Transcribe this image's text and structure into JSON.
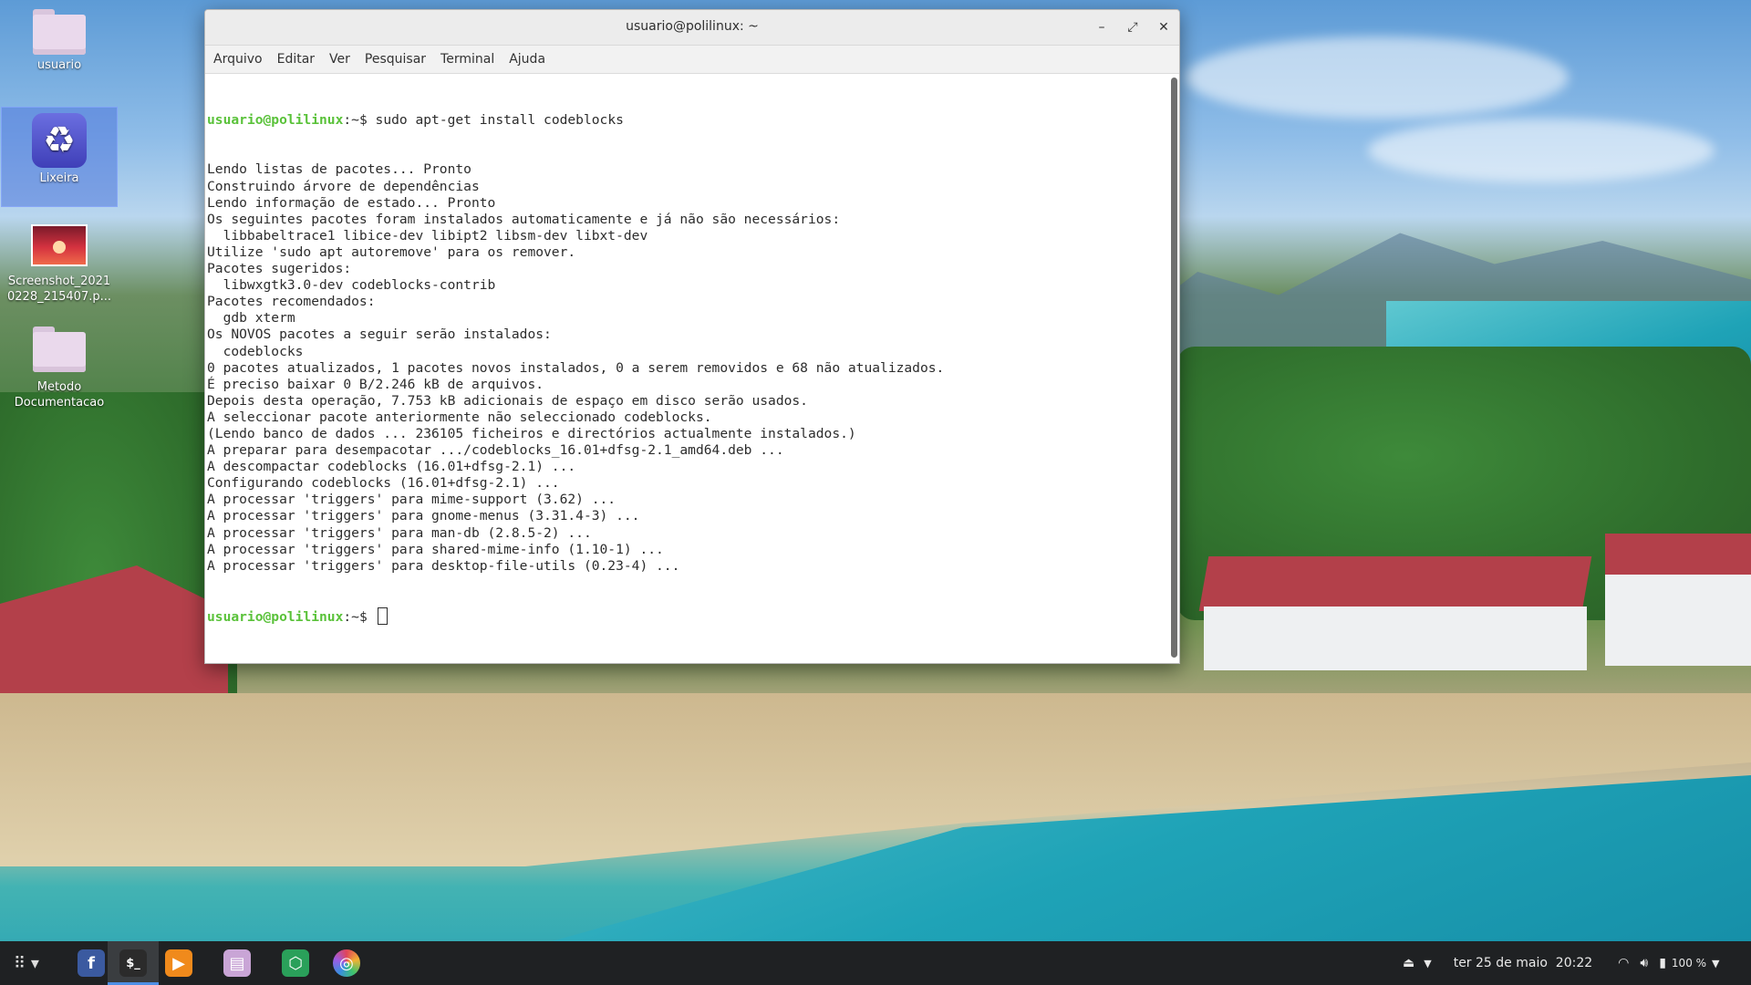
{
  "desktop": {
    "icons": [
      {
        "label": "usuario",
        "icon": "folder-icon"
      },
      {
        "label": "Lixeira",
        "icon": "trash-icon"
      },
      {
        "label": "Screenshot_2021\n0228_215407.p...",
        "icon": "image-file-icon"
      },
      {
        "label": "Metodo\nDocumentacao",
        "icon": "folder-icon"
      }
    ]
  },
  "window": {
    "title": "usuario@polilinux: ~",
    "buttons": {
      "minimize": "–",
      "maximize": "⤢",
      "close": "✕"
    },
    "menu": [
      "Arquivo",
      "Editar",
      "Ver",
      "Pesquisar",
      "Terminal",
      "Ajuda"
    ]
  },
  "terminal": {
    "prompt_user": "usuario@polilinux",
    "prompt_suffix": ":~$ ",
    "command": "sudo apt-get install codeblocks",
    "output": [
      "Lendo listas de pacotes... Pronto",
      "Construindo árvore de dependências",
      "Lendo informação de estado... Pronto",
      "Os seguintes pacotes foram instalados automaticamente e já não são necessários:",
      "  libbabeltrace1 libice-dev libipt2 libsm-dev libxt-dev",
      "Utilize 'sudo apt autoremove' para os remover.",
      "Pacotes sugeridos:",
      "  libwxgtk3.0-dev codeblocks-contrib",
      "Pacotes recomendados:",
      "  gdb xterm",
      "Os NOVOS pacotes a seguir serão instalados:",
      "  codeblocks",
      "0 pacotes atualizados, 1 pacotes novos instalados, 0 a serem removidos e 68 não atualizados.",
      "É preciso baixar 0 B/2.246 kB de arquivos.",
      "Depois desta operação, 7.753 kB adicionais de espaço em disco serão usados.",
      "A seleccionar pacote anteriormente não seleccionado codeblocks.",
      "(Lendo banco de dados ... 236105 ficheiros e directórios actualmente instalados.)",
      "A preparar para desempacotar .../codeblocks_16.01+dfsg-2.1_amd64.deb ...",
      "A descompactar codeblocks (16.01+dfsg-2.1) ...",
      "Configurando codeblocks (16.01+dfsg-2.1) ...",
      "A processar 'triggers' para mime-support (3.62) ...",
      "A processar 'triggers' para gnome-menus (3.31.4-3) ...",
      "A processar 'triggers' para man-db (2.8.5-2) ...",
      "A processar 'triggers' para shared-mime-info (1.10-1) ...",
      "A processar 'triggers' para desktop-file-utils (0.23-4) ..."
    ]
  },
  "taskbar": {
    "apps": [
      {
        "name": "facebook-app",
        "glyph": "f",
        "color": "#3b5aa0"
      },
      {
        "name": "terminal-app",
        "glyph": "$_",
        "color": "#2b2b2b"
      },
      {
        "name": "media-player-app",
        "glyph": "▶",
        "color": "#f08a1c"
      },
      {
        "name": "files-app",
        "glyph": "▤",
        "color": "#c9a5d6"
      },
      {
        "name": "browser-app",
        "glyph": "⬡",
        "color": "#2aa05a"
      },
      {
        "name": "color-app",
        "glyph": "◎",
        "color": "#e0445a"
      }
    ],
    "datetime": "ter 25 de maio  20:22",
    "battery": "100 %"
  }
}
